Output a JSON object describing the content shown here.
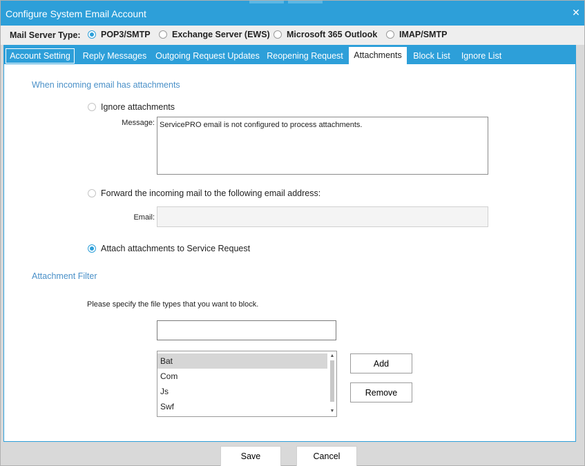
{
  "window": {
    "title": "Configure System Email Account",
    "close_icon": "close-icon"
  },
  "server": {
    "label": "Mail Server Type:",
    "options": [
      "POP3/SMTP",
      "Exchange Server (EWS)",
      "Microsoft 365 Outlook",
      "IMAP/SMTP"
    ],
    "selected": "POP3/SMTP"
  },
  "tabs": [
    "Account Setting",
    "Reply Messages",
    "Outgoing Request Updates",
    "Reopening Request",
    "Attachments",
    "Block List",
    "Ignore List"
  ],
  "active_tab": "Attachments",
  "attachments": {
    "section_title": "When incoming email has attachments",
    "ignore_label": "Ignore attachments",
    "message_label": "Message:",
    "message_value": "ServicePRO email is not configured to process attachments.",
    "forward_label": "Forward the incoming mail to the following email address:",
    "email_label": "Email:",
    "email_value": "",
    "attach_label": "Attach attachments to Service Request",
    "selected_option": "attach"
  },
  "filter": {
    "section_title": "Attachment Filter",
    "hint": "Please specify the file types that you want to block.",
    "input_value": "",
    "items": [
      "Bat",
      "Com",
      "Js",
      "Swf"
    ],
    "selected_item": "Bat",
    "add_label": "Add",
    "remove_label": "Remove"
  },
  "footer": {
    "save_label": "Save",
    "cancel_label": "Cancel"
  },
  "colors": {
    "accent": "#2d9fd9",
    "section_title": "#4a90c8",
    "window_bg": "#d9d9d9"
  }
}
